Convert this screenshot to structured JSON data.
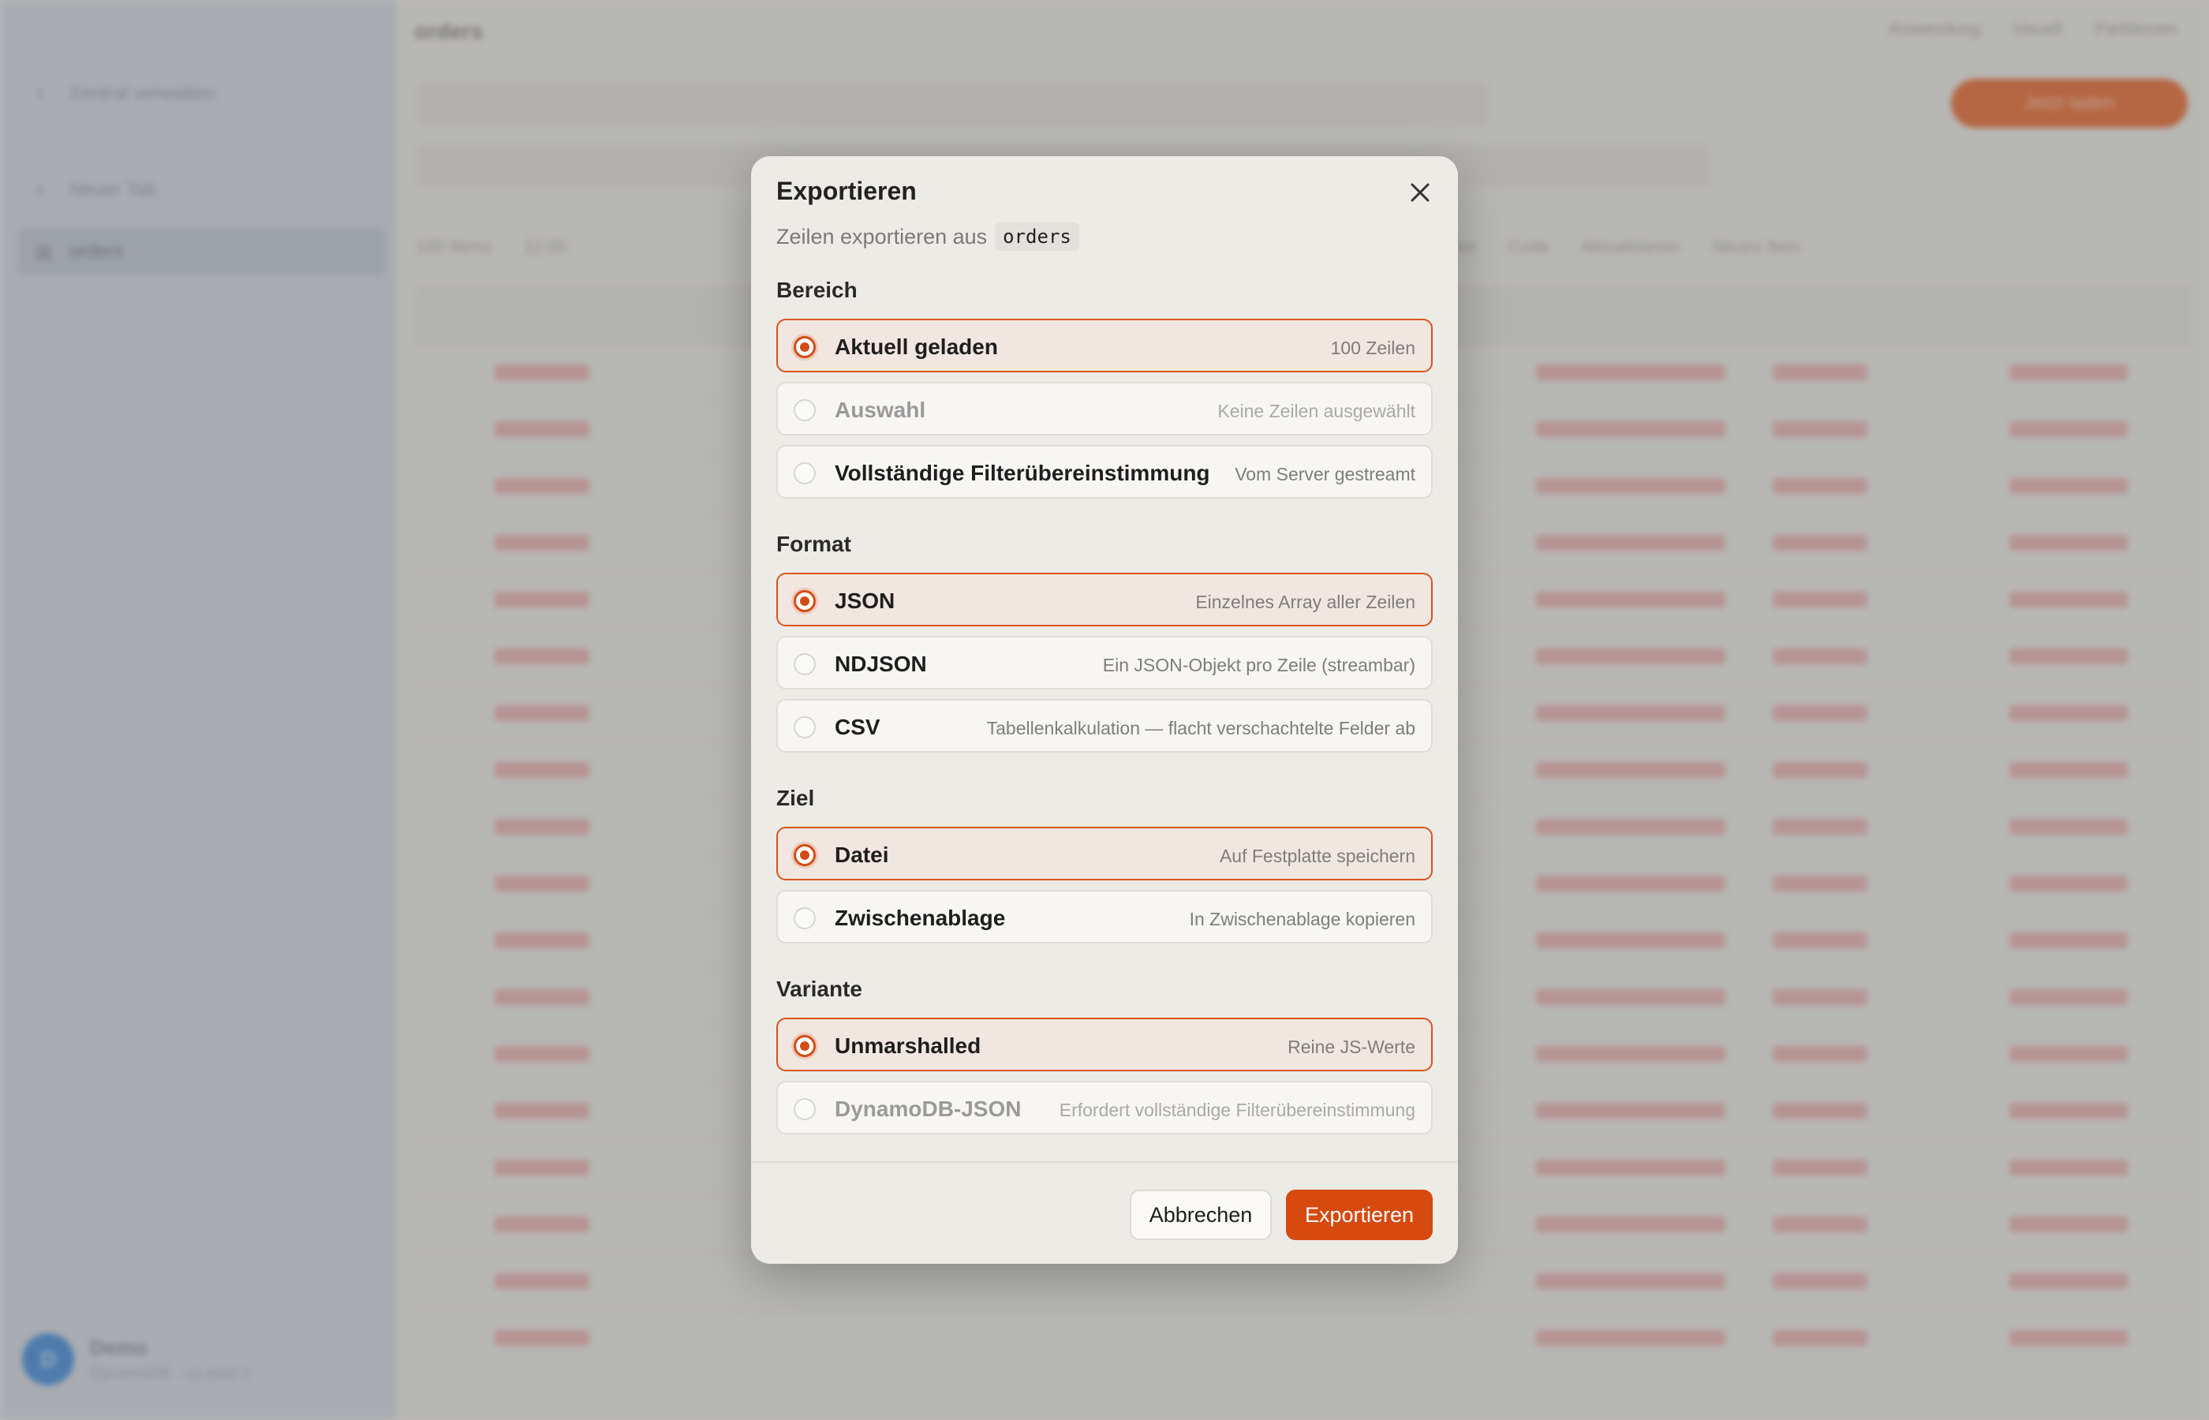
{
  "background": {
    "sidebar": {
      "items": [
        {
          "label": "Zentral verwalten",
          "icon": "plus-icon"
        },
        {
          "label": "Neuer Tab",
          "icon": "plus-icon"
        },
        {
          "label": "orders",
          "icon": "table-icon",
          "active": true
        }
      ],
      "user": {
        "name": "Demo",
        "sub": "DynamoDB · us-east-1",
        "initial": "D"
      }
    },
    "topbar": {
      "title": "orders",
      "actions": [
        "Anwendung",
        "Visuell",
        "Partitionen"
      ]
    },
    "start_button": "Jetzt laden",
    "toolbar3": [
      "100 Items",
      "12:00",
      "Exportieren",
      "Code",
      "Aktualisieren",
      "Neues Item"
    ]
  },
  "modal": {
    "title": "Exportieren",
    "subtitle": "Zeilen exportieren aus",
    "table_name": "orders",
    "close_icon": "close-icon",
    "sections": {
      "range": {
        "label": "Bereich",
        "options": [
          {
            "label": "Aktuell geladen",
            "hint": "100 Zeilen",
            "selected": true,
            "disabled": false
          },
          {
            "label": "Auswahl",
            "hint": "Keine Zeilen ausgewählt",
            "selected": false,
            "disabled": true
          },
          {
            "label": "Vollständige Filterübereinstimmung",
            "hint": "Vom Server gestreamt",
            "selected": false,
            "disabled": false
          }
        ]
      },
      "format": {
        "label": "Format",
        "options": [
          {
            "label": "JSON",
            "hint": "Einzelnes Array aller Zeilen",
            "selected": true,
            "disabled": false
          },
          {
            "label": "NDJSON",
            "hint": "Ein JSON-Objekt pro Zeile (streambar)",
            "selected": false,
            "disabled": false
          },
          {
            "label": "CSV",
            "hint": "Tabellenkalkulation — flacht verschachtelte Felder ab",
            "selected": false,
            "disabled": false
          }
        ]
      },
      "target": {
        "label": "Ziel",
        "options": [
          {
            "label": "Datei",
            "hint": "Auf Festplatte speichern",
            "selected": true,
            "disabled": false
          },
          {
            "label": "Zwischenablage",
            "hint": "In Zwischenablage kopieren",
            "selected": false,
            "disabled": false
          }
        ]
      },
      "variant": {
        "label": "Variante",
        "options": [
          {
            "label": "Unmarshalled",
            "hint": "Reine JS-Werte",
            "selected": true,
            "disabled": false
          },
          {
            "label": "DynamoDB-JSON",
            "hint": "Erfordert vollständige Filterübereinstimmung",
            "selected": false,
            "disabled": true
          }
        ]
      }
    },
    "buttons": {
      "cancel": "Abbrechen",
      "export": "Exportieren"
    },
    "colors": {
      "accent": "#d64a10",
      "selected_bg": "#f2e6e0",
      "modal_bg": "#edebe6"
    }
  }
}
